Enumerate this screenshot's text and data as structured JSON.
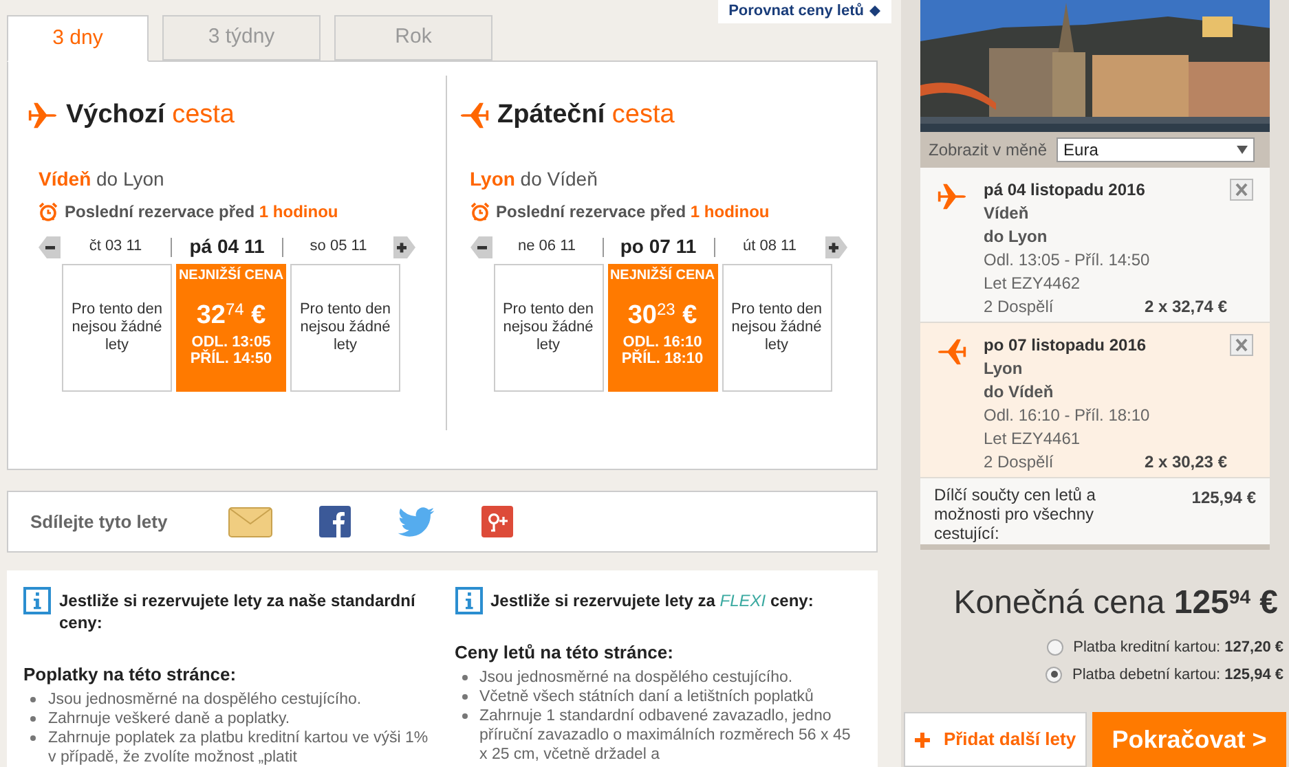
{
  "compare_link": "Porovnat ceny letů",
  "tabs": [
    {
      "label": "3 dny",
      "selected": true
    },
    {
      "label": "3 týdny",
      "selected": false
    },
    {
      "label": "Rok",
      "selected": false
    }
  ],
  "journeys": [
    {
      "title": "Výchozí",
      "title_accent": "cesta",
      "kind": "out",
      "origin": "Vídeň",
      "destination": "do Lyon",
      "deadline": "Poslední rezervace před",
      "deadline_accent": "1 hodinou",
      "days": [
        {
          "label": "čt 03 11",
          "selected": false,
          "kind": "none",
          "text": "Pro tento den nejsou žádné lety"
        },
        {
          "label": "pá 04 11",
          "selected": true,
          "kind": "fare",
          "badge": "NEJNIŽŠÍ CENA",
          "price": "32",
          "cents": "74",
          "currency": "€",
          "depart": "ODL. 13:05",
          "arrive": "PŘÍL. 14:50"
        },
        {
          "label": "so 05 11",
          "selected": false,
          "kind": "none",
          "text": "Pro tento den nejsou žádné lety"
        }
      ]
    },
    {
      "title": "Zpáteční",
      "title_accent": "cesta",
      "kind": "back",
      "origin": "Lyon",
      "destination": "do Vídeň",
      "deadline": "Poslední rezervace před",
      "deadline_accent": "1 hodinou",
      "days": [
        {
          "label": "ne 06 11",
          "selected": false,
          "kind": "none",
          "text": "Pro tento den nejsou žádné lety"
        },
        {
          "label": "po 07 11",
          "selected": true,
          "kind": "fare",
          "badge": "NEJNIŽŠÍ CENA",
          "price": "30",
          "cents": "23",
          "currency": "€",
          "depart": "ODL. 16:10",
          "arrive": "PŘÍL. 18:10"
        },
        {
          "label": "út 08 11",
          "selected": false,
          "kind": "none",
          "text": "Pro tento den nejsou žádné lety"
        }
      ]
    }
  ],
  "share": {
    "label": "Sdílejte tyto lety"
  },
  "info": [
    {
      "title": "Jestliže si rezervujete lety za naše standardní ceny:",
      "subtitle": "Poplatky na této stránce:",
      "items": [
        "Jsou jednosměrné na dospělého cestujícího.",
        "Zahrnuje veškeré daně a poplatky.",
        "Zahrnuje poplatek za platbu kreditní kartou ve výši 1% v případě, že zvolíte možnost „platit"
      ]
    },
    {
      "title": "Jestliže si rezervujete lety za",
      "title_highlight": "FLEXI",
      "title_after": "ceny:",
      "subtitle": "Ceny letů na této stránce:",
      "items": [
        "Jsou jednosměrné na dospělého cestujícího.",
        "Včetně všech státních daní a letištních poplatků",
        "Zahrnuje 1 standardní odbavené zavazadlo, jedno příruční zavazadlo o maximálních rozměrech 56 x 45 x 25 cm, včetně držadel a"
      ]
    }
  ],
  "basket": {
    "currency_label": "Zobrazit v měně",
    "currency_value": "Eura",
    "flights": [
      {
        "date": "pá 04 listopadu 2016",
        "from": "Vídeň",
        "to": "do Lyon",
        "times": "Odl. 13:05 - Příl. 14:50",
        "flight": "Let EZY4462",
        "passengers": "2 Dospělí",
        "price": "2 x 32,74 €",
        "kind": "out",
        "highlighted": false
      },
      {
        "date": "po 07 listopadu 2016",
        "from": "Lyon",
        "to": "do Vídeň",
        "times": "Odl. 16:10 - Příl. 18:10",
        "flight": "Let EZY4461",
        "passengers": "2 Dospělí",
        "price": "2 x 30,23 €",
        "kind": "back",
        "highlighted": true
      }
    ],
    "subtotal_label": "Dílčí součty cen letů a možnosti pro všechny cestující:",
    "subtotal_value": "125,94 €",
    "total_label": "Konečná cena",
    "total_main": "125",
    "total_cents": "94",
    "total_currency": "€",
    "payments": [
      {
        "label": "Platba kreditní kartou:",
        "amount": "127,20 €",
        "selected": false
      },
      {
        "label": "Platba debetní kartou:",
        "amount": "125,94 €",
        "selected": true
      }
    ],
    "add_button": "Přidat další lety",
    "continue_button": "Pokračovat >"
  }
}
